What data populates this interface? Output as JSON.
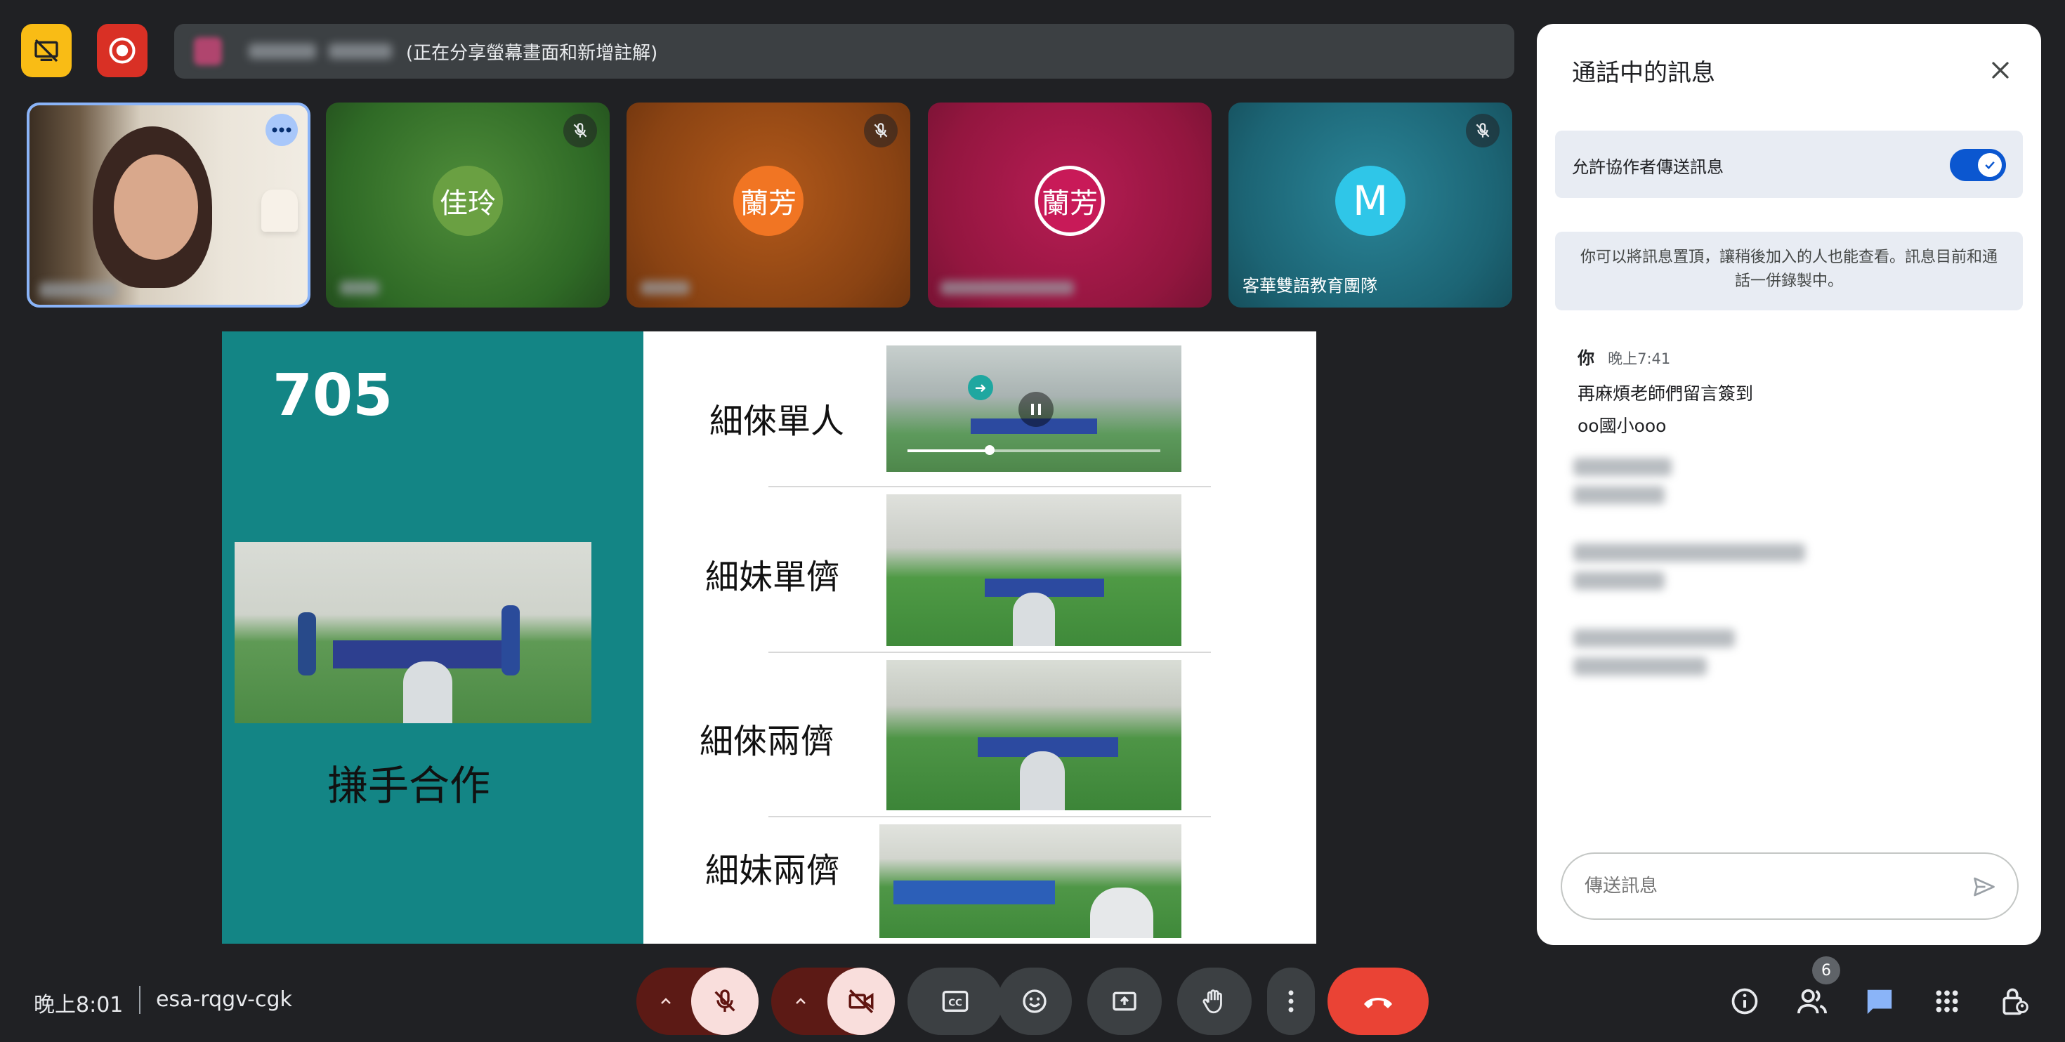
{
  "top": {
    "presenting_text": "(正在分享螢幕畫面和新增註解)"
  },
  "tiles": [
    {
      "name": "",
      "initial": ""
    },
    {
      "name": "",
      "initial": "佳玲"
    },
    {
      "name": "",
      "initial": "蘭芳"
    },
    {
      "name": "",
      "initial": "蘭芳"
    },
    {
      "name": "客華雙語教育團隊",
      "initial": "M"
    }
  ],
  "slide": {
    "class_number": "705",
    "left_caption": "搛手合作",
    "rows": [
      {
        "label": "細倈單人"
      },
      {
        "label": "細妹單儕"
      },
      {
        "label": "細倈兩儕"
      },
      {
        "label": "細妹兩儕"
      }
    ]
  },
  "chat": {
    "title": "通話中的訊息",
    "allow_label": "允許協作者傳送訊息",
    "allow_enabled": true,
    "info_text": "你可以將訊息置頂，讓稍後加入的人也能查看。訊息目前和通話一併錄製中。",
    "message": {
      "sender": "你",
      "time": "晚上7:41",
      "lines": [
        "再麻煩老師們留言簽到",
        "oo國小ooo"
      ]
    },
    "input_placeholder": "傳送訊息"
  },
  "bottom": {
    "time": "晚上8:01",
    "meeting_code": "esa-rqgv-cgk",
    "participants_count": "6"
  },
  "colors": {
    "end_call": "#ea4335",
    "accent_blue": "#0b57d0",
    "muted_bg": "#f9dedc",
    "slide_teal": "#138585"
  }
}
